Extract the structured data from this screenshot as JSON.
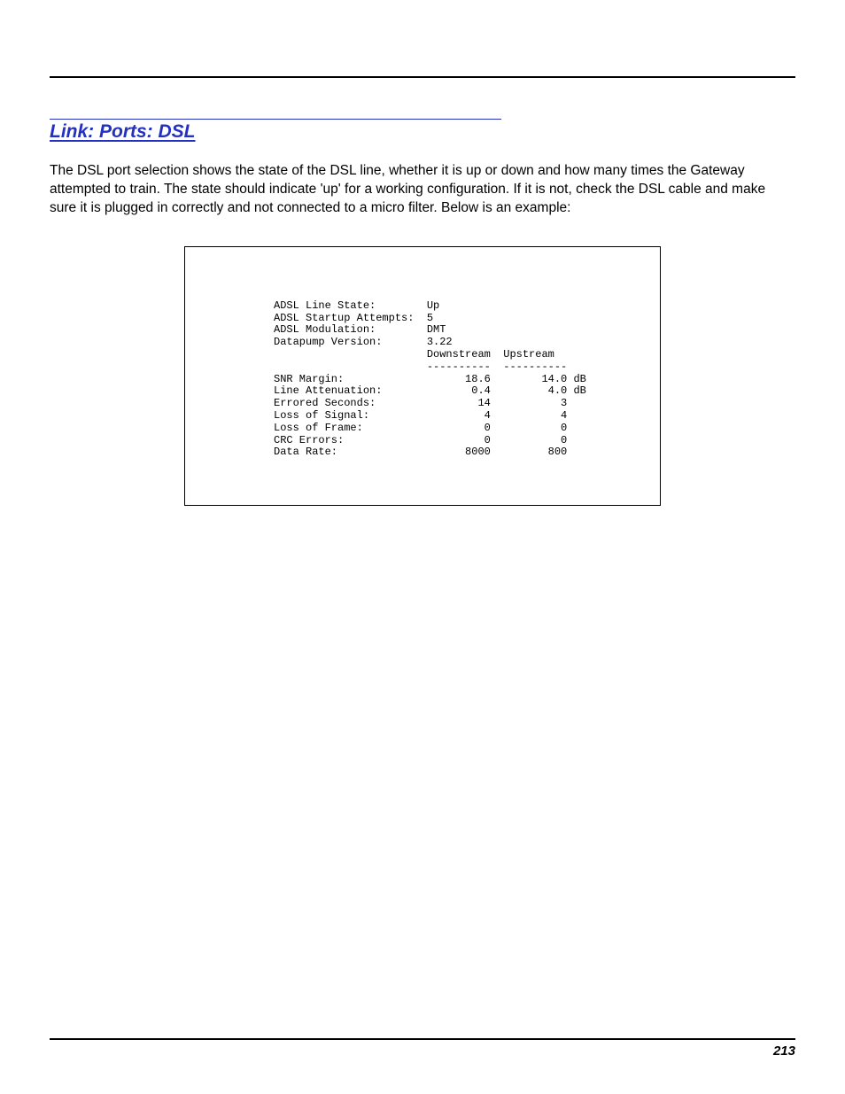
{
  "heading": "Link: Ports: DSL",
  "body_text": "The DSL port selection shows the state of the DSL line, whether it is up or down and how many times the Gateway attempted to train. The state should indicate 'up' for a working configuration. If it is not, check the DSL cable and make sure it is plugged in correctly and not connected to a micro filter. Below is an example:",
  "terminal": {
    "lines": [
      {
        "label": "ADSL Line State:",
        "value": "Up"
      },
      {
        "label": "ADSL Startup Attempts:",
        "value": "5"
      },
      {
        "label": "ADSL Modulation:",
        "value": "DMT"
      },
      {
        "label": "Datapump Version:",
        "value": "3.22"
      }
    ],
    "columns": {
      "down": "Downstream",
      "up": "Upstream"
    },
    "separator": {
      "down": "----------",
      "up": "----------"
    },
    "rows": [
      {
        "label": "SNR Margin:",
        "down": "18.6",
        "up": "14.0",
        "unit": "dB"
      },
      {
        "label": "Line Attenuation:",
        "down": "0.4",
        "up": "4.0",
        "unit": "dB"
      },
      {
        "label": "Errored Seconds:",
        "down": "14",
        "up": "3",
        "unit": ""
      },
      {
        "label": "Loss of Signal:",
        "down": "4",
        "up": "4",
        "unit": ""
      },
      {
        "label": "Loss of Frame:",
        "down": "0",
        "up": "0",
        "unit": ""
      },
      {
        "label": "CRC Errors:",
        "down": "0",
        "up": "0",
        "unit": ""
      },
      {
        "label": "Data Rate:",
        "down": "8000",
        "up": "800",
        "unit": ""
      }
    ]
  },
  "page_number": "213"
}
